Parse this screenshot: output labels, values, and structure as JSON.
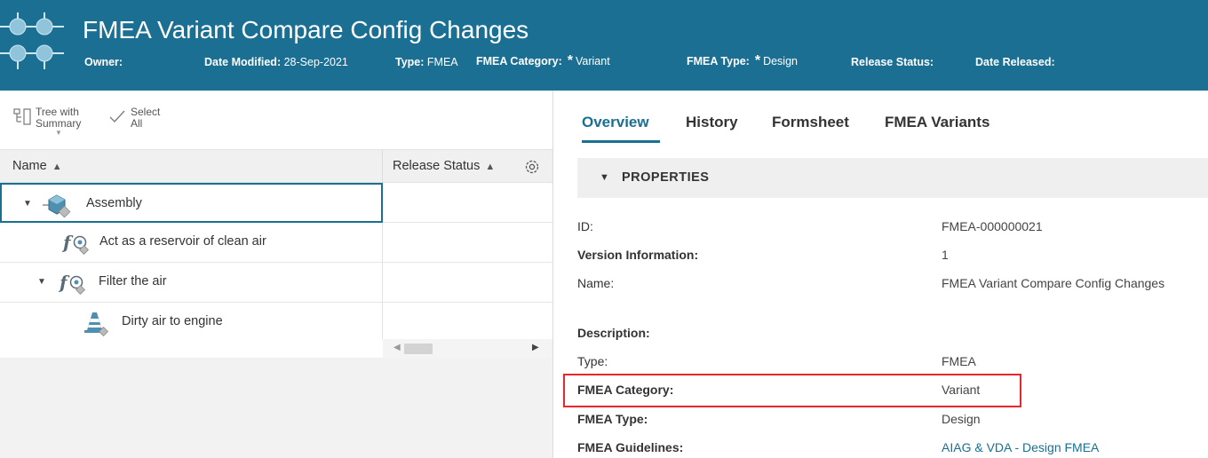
{
  "header": {
    "title": "FMEA Variant Compare Config Changes",
    "owner_label": "Owner:",
    "date_modified_label": "Date Modified:",
    "date_modified_value": "28-Sep-2021",
    "type_label": "Type:",
    "type_value": "FMEA",
    "fmea_category_label": "FMEA Category:",
    "fmea_category_value": "Variant",
    "fmea_type_label": "FMEA Type:",
    "fmea_type_value": "Design",
    "release_status_label": "Release Status:",
    "date_released_label": "Date Released:",
    "star": "*"
  },
  "toolbar": {
    "tree_label_1": "Tree with",
    "tree_label_2": "Summary",
    "select_label_1": "Select",
    "select_label_2": "All"
  },
  "tree": {
    "columns": {
      "name": "Name",
      "release_status": "Release Status"
    },
    "rows": [
      {
        "label": "Assembly",
        "icon": "assembly-icon"
      },
      {
        "label": "Act as a reservoir of clean air",
        "icon": "function-icon"
      },
      {
        "label": "Filter the air",
        "icon": "function-icon"
      },
      {
        "label": "Dirty air to engine",
        "icon": "failure-cone-icon"
      }
    ]
  },
  "tabs": [
    "Overview",
    "History",
    "Formsheet",
    "FMEA Variants"
  ],
  "properties": {
    "section_title": "PROPERTIES",
    "items": [
      {
        "label": "ID:",
        "value": "FMEA-000000021"
      },
      {
        "label": "Version Information:",
        "value": "1"
      },
      {
        "label": "Name:",
        "value": "FMEA Variant Compare Config Changes"
      },
      {
        "label": "Description:",
        "value": ""
      },
      {
        "label": "Type:",
        "value": "FMEA"
      },
      {
        "label": "FMEA Category:",
        "value": "Variant"
      },
      {
        "label": "FMEA Type:",
        "value": "Design"
      },
      {
        "label": "FMEA Guidelines:",
        "value": "AIAG & VDA - Design FMEA"
      }
    ]
  },
  "colors": {
    "header_bg": "#1a6f93",
    "accent": "#1a6f93",
    "highlight": "#e8262b"
  }
}
